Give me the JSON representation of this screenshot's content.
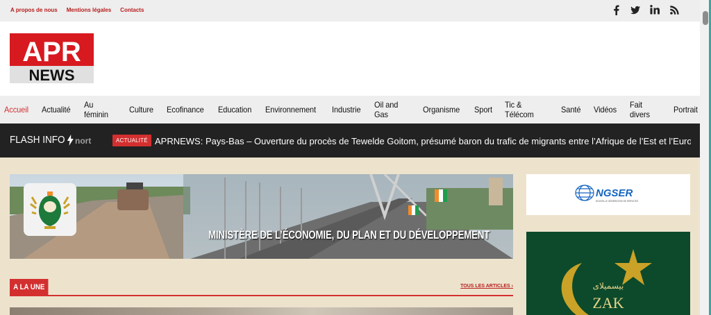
{
  "top_links": [
    "A propos de nous",
    "Mentions légales",
    "Contacts"
  ],
  "social_icons": [
    "facebook-icon",
    "twitter-icon",
    "linkedin-icon",
    "rss-icon"
  ],
  "logo": {
    "top": "APR",
    "bottom": "NEWS"
  },
  "nav": {
    "items": [
      "Accueil",
      "Actualité",
      "Au féminin",
      "Culture",
      "Ecofinance",
      "Education",
      "Environnement",
      "Industrie",
      "Oil and Gas",
      "Organisme",
      "Sport",
      "Tic & Télécom",
      "Santé",
      "Vidéos",
      "Fait divers",
      "Portrait"
    ],
    "active": "Accueil"
  },
  "flash": {
    "title": "FLASH INFO",
    "previous_fragment": "nort",
    "badge": "ACTUALITÉ",
    "headline": "APRNEWS: Pays-Bas – Ouverture du procès de Tewelde Goitom, présumé baron du trafic de migrants entre l’Afrique de l’Est et l’Europe"
  },
  "banner": {
    "text": "MINISTÈRE DE L’ÉCONOMIE, DU PLAN ET DU DÉVELOPPEMENT"
  },
  "une": {
    "title": "A LA UNE",
    "link": "TOUS LES ARTICLES ›"
  },
  "ads": {
    "ngser": {
      "name": "NGSER",
      "tagline": "NOUVELLE GÉNÉRATION DE SERVICES"
    },
    "zak": {
      "arabic": "بيسميلاى",
      "latin": "ZAK"
    }
  },
  "colors": {
    "accent": "#d32f2f",
    "dark": "#222222",
    "content_bg": "#ede3cd"
  }
}
